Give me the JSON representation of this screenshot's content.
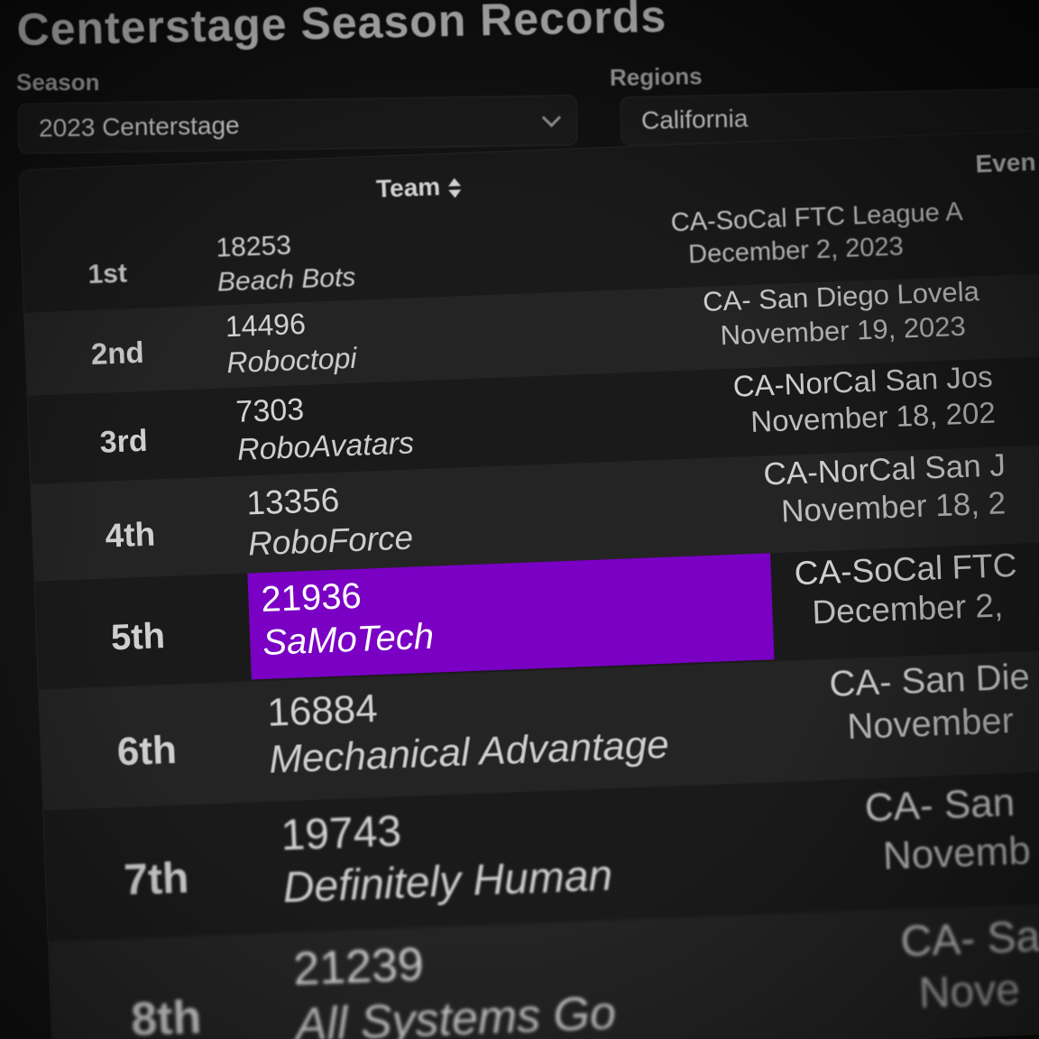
{
  "page": {
    "title": "Centerstage Season Records"
  },
  "filters": {
    "season_label": "Season",
    "season_value": "2023 Centerstage",
    "regions_label": "Regions",
    "regions_value": "California"
  },
  "table": {
    "columns": {
      "team": "Team",
      "event": "Even"
    },
    "highlight_color": "#7a00c4",
    "rows": [
      {
        "rank": "1st",
        "number": "18253",
        "name": "Beach Bots",
        "event": "CA-SoCal FTC League A",
        "date": "December 2, 2023"
      },
      {
        "rank": "2nd",
        "number": "14496",
        "name": "Roboctopi",
        "event": "CA- San Diego Lovela",
        "date": "November 19, 2023"
      },
      {
        "rank": "3rd",
        "number": "7303",
        "name": "RoboAvatars",
        "event": "CA-NorCal San Jos",
        "date": "November 18, 202"
      },
      {
        "rank": "4th",
        "number": "13356",
        "name": "RoboForce",
        "event": "CA-NorCal San J",
        "date": "November 18, 2"
      },
      {
        "rank": "5th",
        "number": "21936",
        "name": "SaMoTech",
        "event": "CA-SoCal FTC",
        "date": "December 2,"
      },
      {
        "rank": "6th",
        "number": "16884",
        "name": "Mechanical Advantage",
        "event": "CA- San Die",
        "date": "November"
      },
      {
        "rank": "7th",
        "number": "19743",
        "name": "Definitely Human",
        "event": "CA- San",
        "date": "Novemb"
      },
      {
        "rank": "8th",
        "number": "21239",
        "name": "All Systems Go",
        "event": "CA- Sa",
        "date": "Nove"
      }
    ]
  }
}
